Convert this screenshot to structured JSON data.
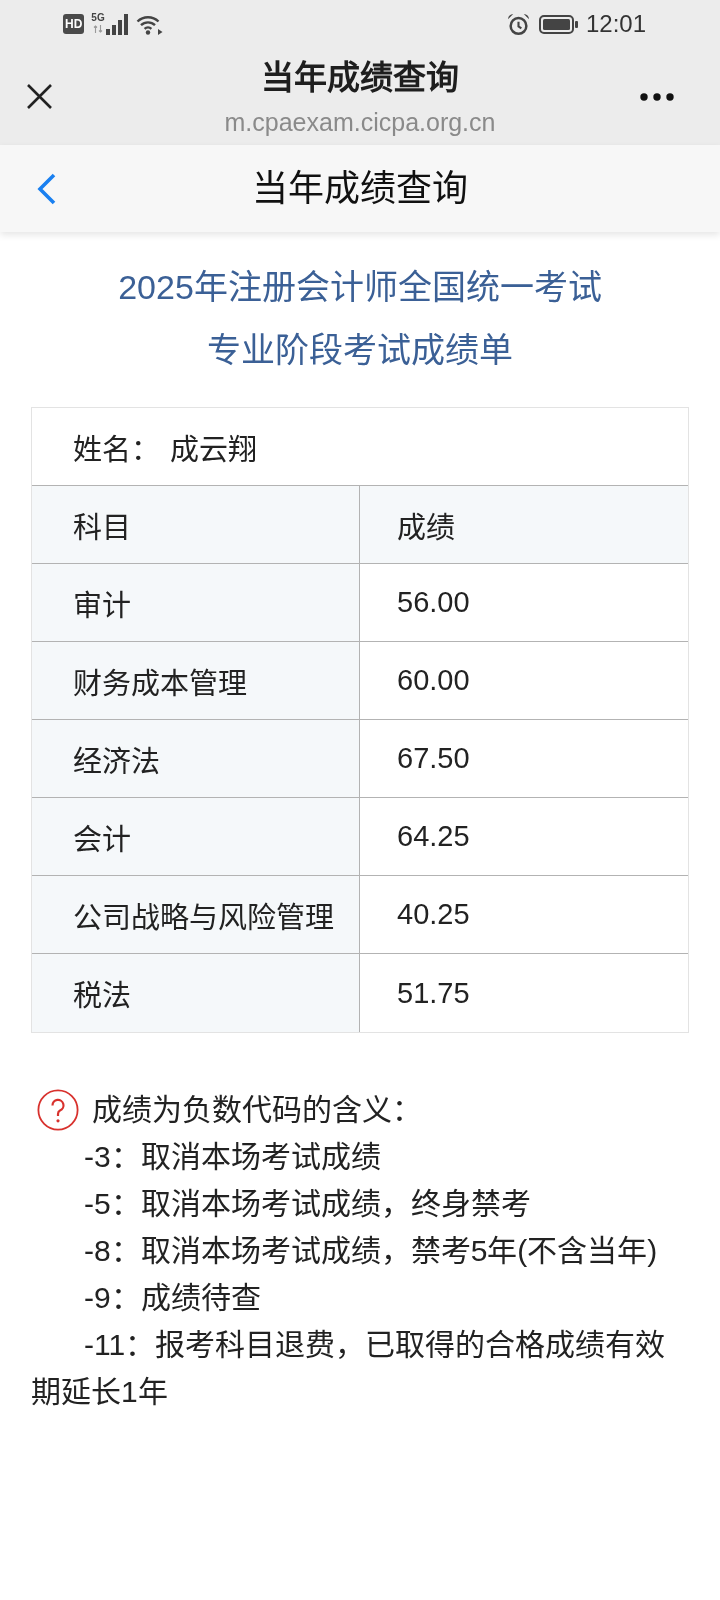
{
  "status_bar": {
    "hd_badge": "HD",
    "network": "5G",
    "time": "12:01"
  },
  "browser_bar": {
    "title": "当年成绩查询",
    "url": "m.cpaexam.cicpa.org.cn"
  },
  "nav_bar": {
    "title": "当年成绩查询"
  },
  "report": {
    "title_lines": [
      "2025年注册会计师全国统一考试",
      "专业阶段考试成绩单"
    ],
    "name": {
      "label": "姓名：",
      "value": "成云翔"
    },
    "columns": [
      "科目",
      "成绩"
    ],
    "rows": [
      {
        "subject": "审计",
        "score": "56.00"
      },
      {
        "subject": "财务成本管理",
        "score": "60.00"
      },
      {
        "subject": "经济法",
        "score": "67.50"
      },
      {
        "subject": "会计",
        "score": "64.25"
      },
      {
        "subject": "公司战略与风险管理",
        "score": "40.25"
      },
      {
        "subject": "税法",
        "score": "51.75"
      }
    ]
  },
  "notes": {
    "heading": "成绩为负数代码的含义：",
    "items": [
      "-3：取消本场考试成绩",
      "-5：取消本场考试成绩，终身禁考",
      "-8：取消本场考试成绩，禁考5年(不含当年)",
      "-9：成绩待查",
      "-11：报考科目退费，已取得的合格成绩有效期延长1年"
    ]
  }
}
